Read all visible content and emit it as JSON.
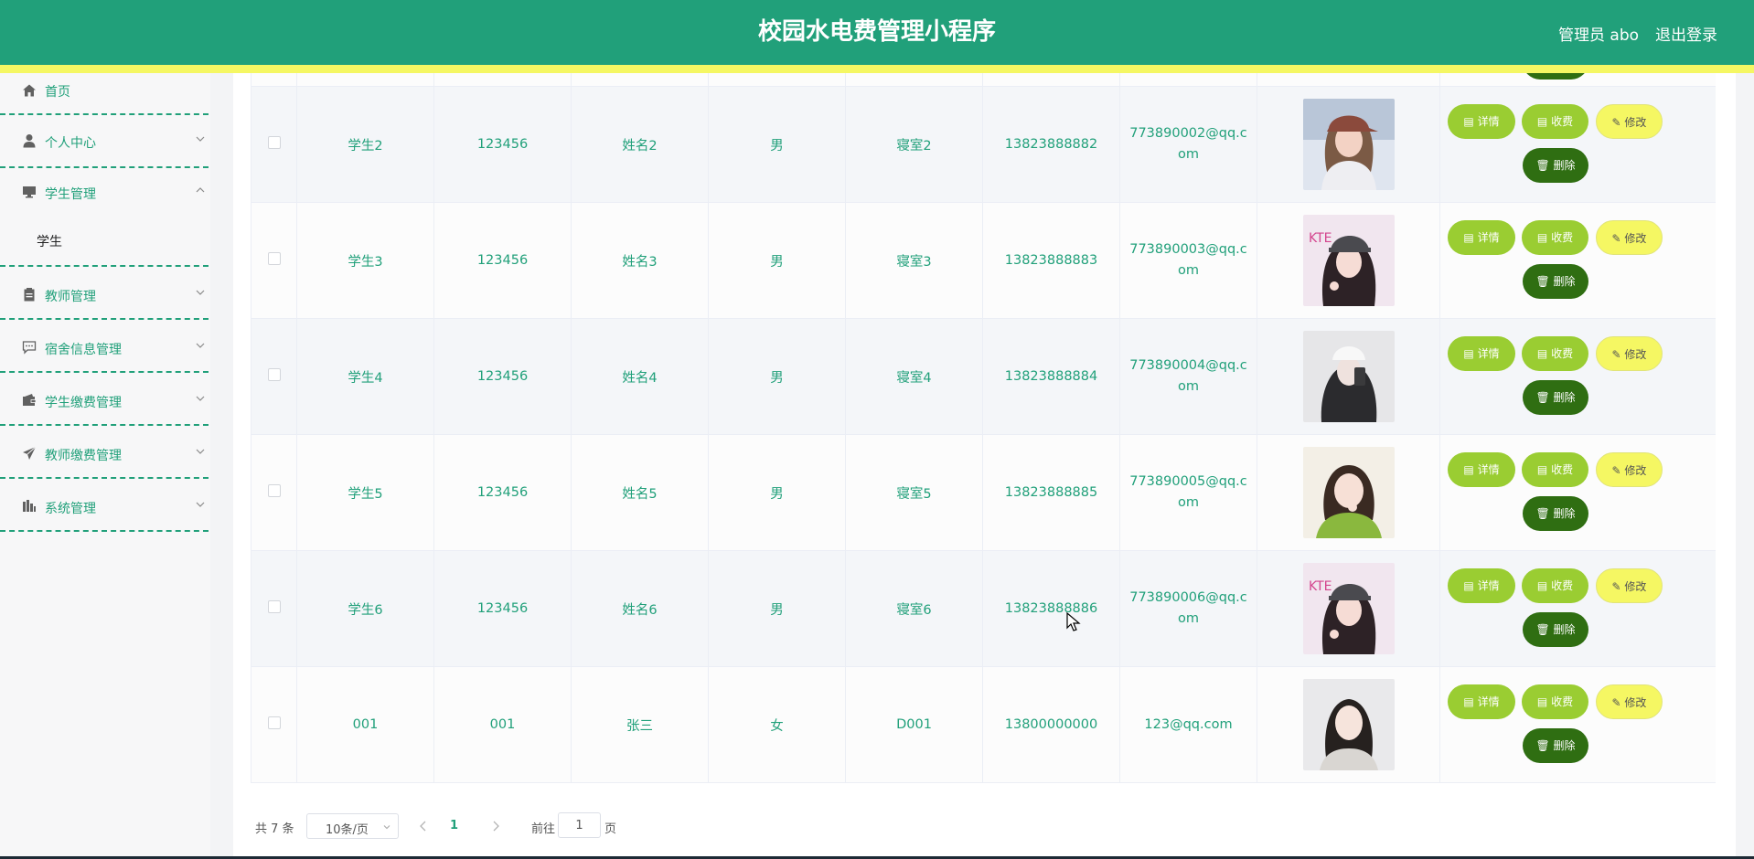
{
  "header": {
    "title": "校园水电费管理小程序",
    "admin_label": "管理员 abo",
    "logout_label": "退出登录",
    "brand_color": "#21a07a",
    "accent_color": "#f5f763"
  },
  "sidebar": {
    "items": [
      {
        "label": "首页",
        "icon": "home-icon"
      },
      {
        "label": "个人中心",
        "icon": "person-icon",
        "chevron": "down"
      },
      {
        "label": "学生管理",
        "icon": "monitor-icon",
        "chevron": "up",
        "children": [
          "学生"
        ]
      },
      {
        "label": "教师管理",
        "icon": "clipboard-icon",
        "chevron": "down"
      },
      {
        "label": "宿舍信息管理",
        "icon": "chat-icon",
        "chevron": "down"
      },
      {
        "label": "学生缴费管理",
        "icon": "wallet-icon",
        "chevron": "down"
      },
      {
        "label": "教师缴费管理",
        "icon": "send-icon",
        "chevron": "down"
      },
      {
        "label": "系统管理",
        "icon": "chart-bars-icon",
        "chevron": "down"
      }
    ]
  },
  "table": {
    "rows": [
      {
        "account": "学生2",
        "password": "123456",
        "name": "姓名2",
        "gender": "男",
        "dorm": "寝室2",
        "phone": "13823888882",
        "email": "773890002@qq.com",
        "photo": "photo-girl-cap"
      },
      {
        "account": "学生3",
        "password": "123456",
        "name": "姓名3",
        "gender": "男",
        "dorm": "寝室3",
        "phone": "13823888883",
        "email": "773890003@qq.com",
        "photo": "photo-girl-cap-pose"
      },
      {
        "account": "学生4",
        "password": "123456",
        "name": "姓名4",
        "gender": "男",
        "dorm": "寝室4",
        "phone": "13823888884",
        "email": "773890004@qq.com",
        "photo": "photo-girl-mirror"
      },
      {
        "account": "学生5",
        "password": "123456",
        "name": "姓名5",
        "gender": "男",
        "dorm": "寝室5",
        "phone": "13823888885",
        "email": "773890005@qq.com",
        "photo": "photo-girl-green"
      },
      {
        "account": "学生6",
        "password": "123456",
        "name": "姓名6",
        "gender": "男",
        "dorm": "寝室6",
        "phone": "13823888886",
        "email": "773890006@qq.com",
        "photo": "photo-girl-cap-pose"
      },
      {
        "account": "001",
        "password": "001",
        "name": "张三",
        "gender": "女",
        "dorm": "D001",
        "phone": "13800000000",
        "email": "123@qq.com",
        "photo": "photo-girl-portrait"
      }
    ],
    "actions": {
      "detail": "详情",
      "collect": "收费",
      "edit": "修改",
      "delete": "删除"
    }
  },
  "pagination": {
    "total": "共 7 条",
    "page_size": "10条/页",
    "current_page": "1",
    "goto_label": "前往",
    "goto_value": "1",
    "page_suffix": "页"
  }
}
